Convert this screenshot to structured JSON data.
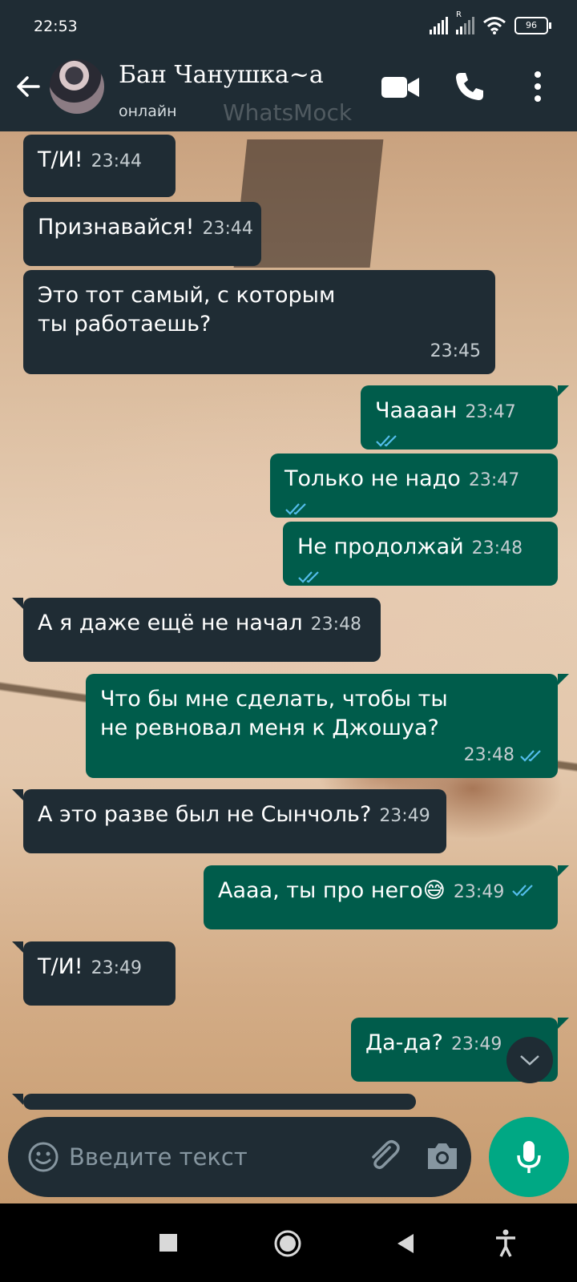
{
  "status_bar": {
    "time": "22:53",
    "battery": "96",
    "roaming": "R"
  },
  "header": {
    "contact_name": "Бан Чанушка~а",
    "status": "онлайн",
    "watermark": "WhatsMock"
  },
  "messages": [
    {
      "dir": "in",
      "text": "Т/И!",
      "time": "23:44"
    },
    {
      "dir": "in",
      "text": "Признавайся!",
      "time": "23:44"
    },
    {
      "dir": "in",
      "text": "Это тот самый, с которым ты работаешь?",
      "time": "23:45"
    },
    {
      "dir": "out",
      "text": "Чаааан",
      "time": "23:47",
      "read": true
    },
    {
      "dir": "out",
      "text": "Только не надо",
      "time": "23:47",
      "read": true
    },
    {
      "dir": "out",
      "text": "Не продолжай",
      "time": "23:48",
      "read": true
    },
    {
      "dir": "in",
      "text": "А я даже ещё не начал",
      "time": "23:48"
    },
    {
      "dir": "out",
      "text": "Что бы мне сделать, чтобы ты не ревновал меня к Джошуа?",
      "time": "23:48",
      "read": true
    },
    {
      "dir": "in",
      "text": "А это разве был не Сынчоль?",
      "time": "23:49"
    },
    {
      "dir": "out",
      "text": "Аааа, ты про него😅",
      "time": "23:49",
      "read": true
    },
    {
      "dir": "in",
      "text": "Т/И!",
      "time": "23:49"
    },
    {
      "dir": "out",
      "text": "Да-да?",
      "time": "23:49",
      "read": true
    }
  ],
  "input": {
    "placeholder": "Введите текст",
    "value": ""
  },
  "colors": {
    "header_bg": "#1f2c34",
    "incoming_bubble": "#1f2c34",
    "outgoing_bubble": "#005c4b",
    "read_ticks": "#53bdeb",
    "mic_button": "#00a884"
  },
  "icons": {
    "back": "arrow-left-icon",
    "video": "video-camera-icon",
    "call": "phone-icon",
    "menu": "more-vertical-icon",
    "emoji": "emoji-icon",
    "attach": "paperclip-icon",
    "camera": "camera-icon",
    "mic": "microphone-icon",
    "scroll": "chevron-down-icon"
  }
}
